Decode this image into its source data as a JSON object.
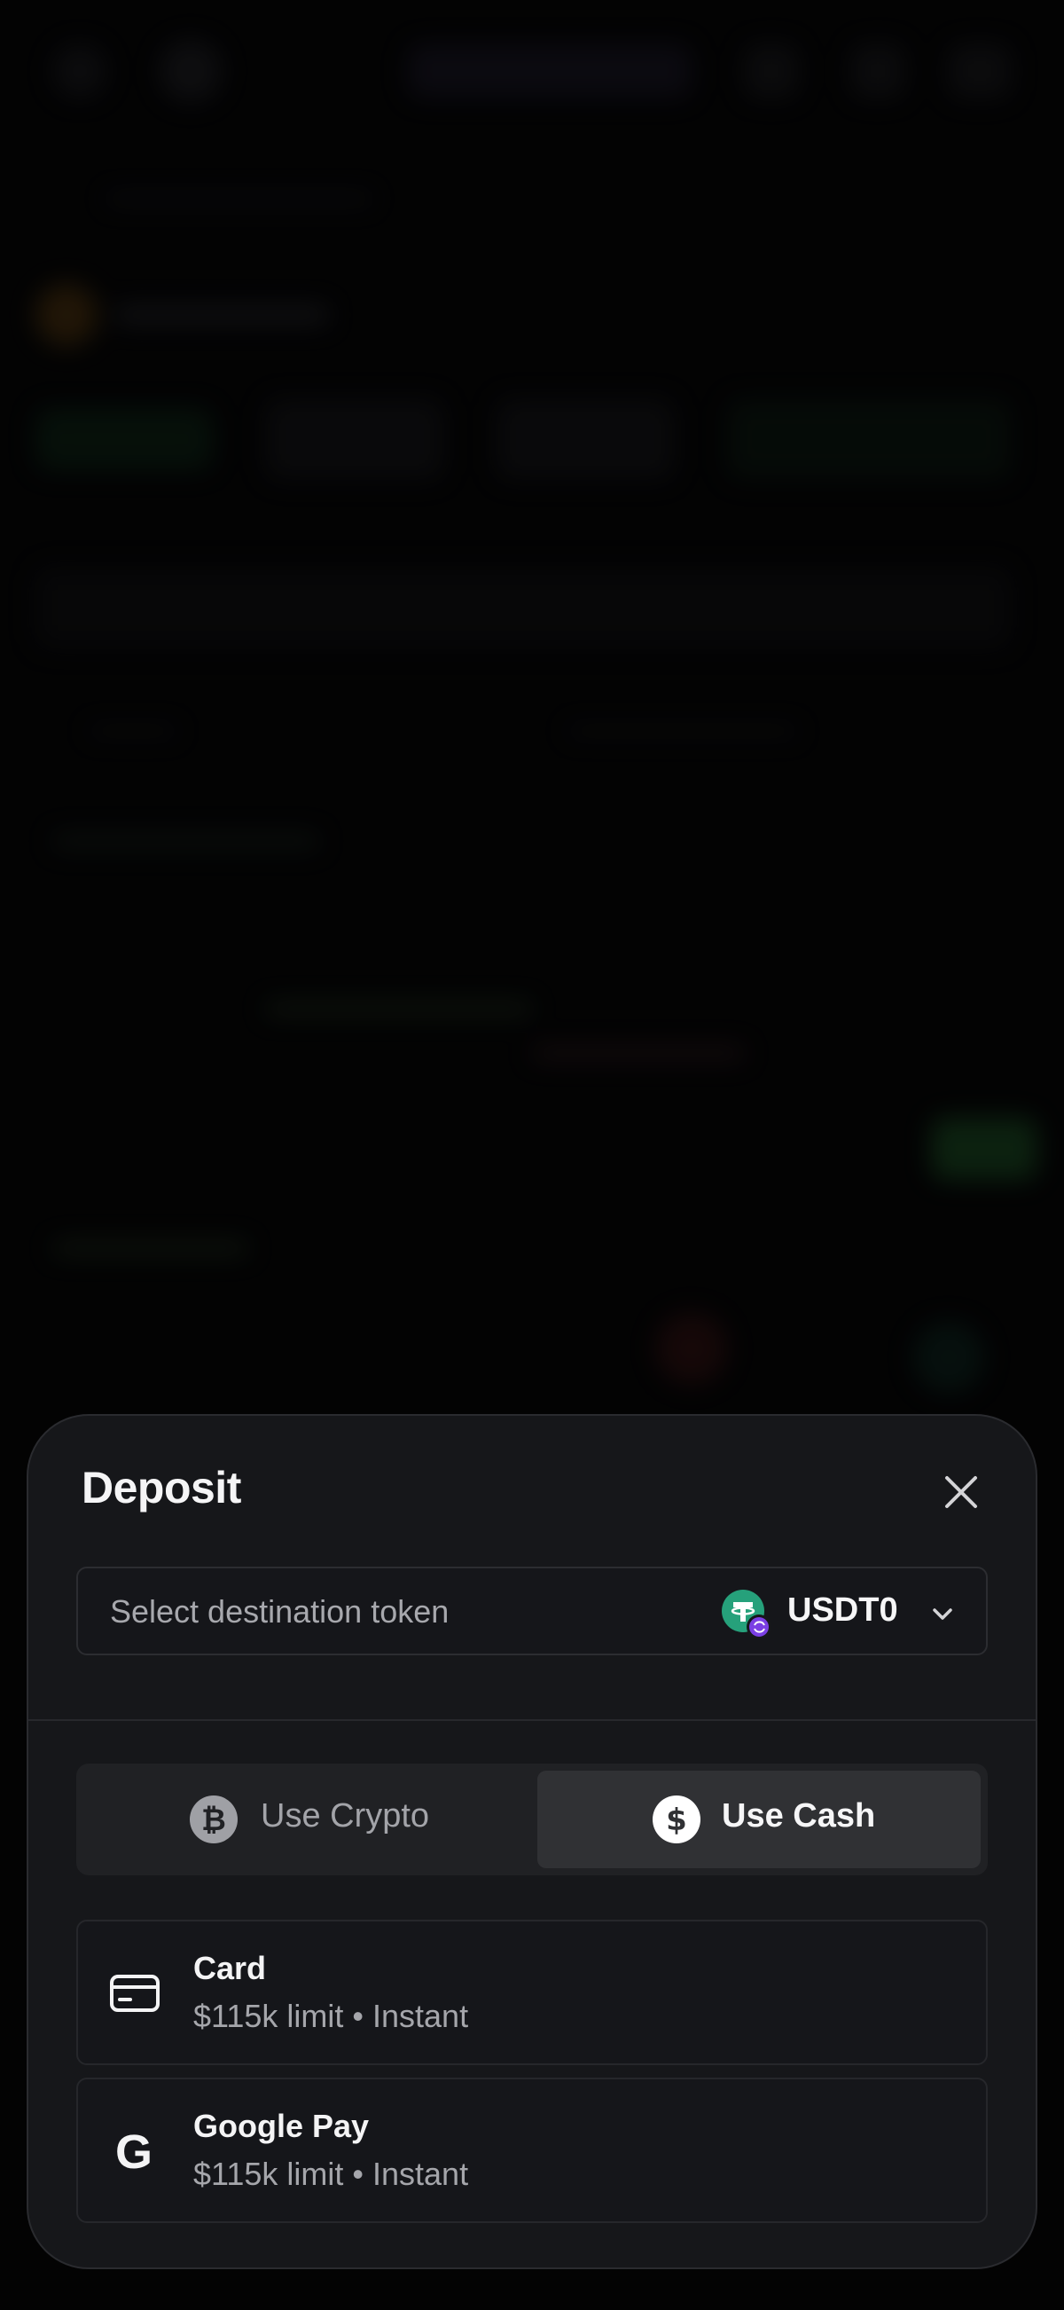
{
  "modal": {
    "title": "Deposit",
    "destination": {
      "placeholder": "Select destination token",
      "token": "USDT0"
    },
    "method_toggle": {
      "crypto_label": "Use Crypto",
      "cash_label": "Use Cash",
      "selected": "cash"
    },
    "options": [
      {
        "name": "Card",
        "detail": "$115k limit • Instant",
        "icon": "card-icon"
      },
      {
        "name": "Google Pay",
        "detail": "$115k limit • Instant",
        "icon": "google-icon"
      }
    ]
  },
  "colors": {
    "sheet_bg": "#16171a",
    "token_green": "#26a17b",
    "token_badge": "#7b3fe4",
    "active_segment": "#303134"
  }
}
